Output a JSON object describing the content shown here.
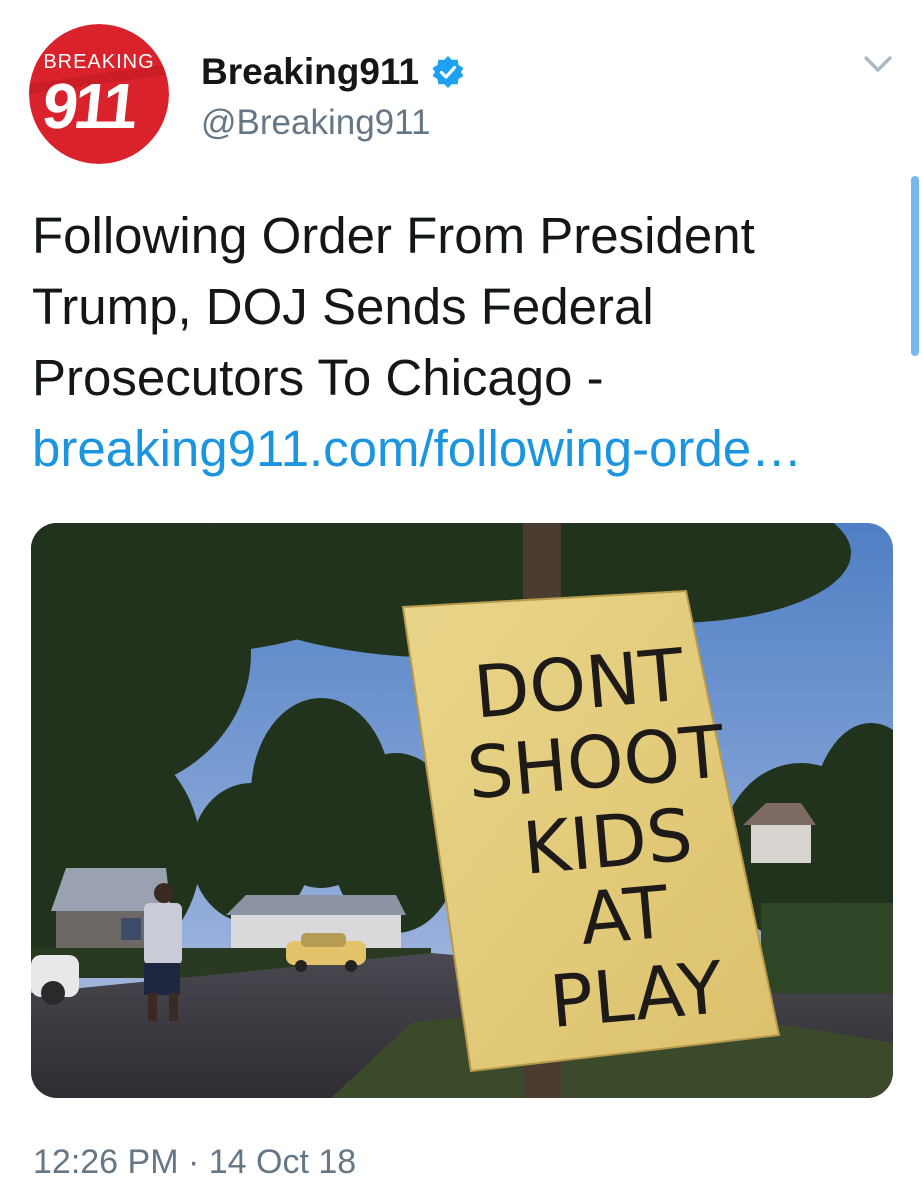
{
  "tweet": {
    "author": {
      "display_name": "Breaking911",
      "handle": "@Breaking911",
      "verified": true,
      "avatar_logo": {
        "word": "BREAKING",
        "number": "911",
        "background_color": "#d9222c"
      }
    },
    "text": "Following Order From President Trump, DOJ Sends Federal Prosecutors To Chicago -",
    "link_text": "breaking911.com/following-orde…",
    "link_color": "#1b95e0",
    "photo": {
      "sign_lines": [
        "DONT",
        "SHOOT",
        "KIDS",
        "AT",
        "PLAY"
      ]
    },
    "timestamp": {
      "time": "12:26 PM",
      "separator": "·",
      "date": "14 Oct 18"
    },
    "icons": {
      "verified": "verified-badge-icon",
      "menu": "chevron-down-icon"
    }
  }
}
